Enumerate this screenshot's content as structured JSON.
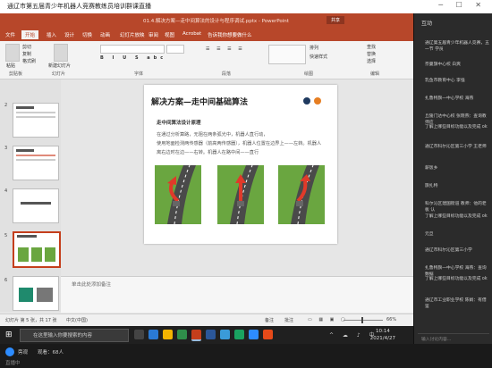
{
  "live_title": "通辽市第五届青少年机器人竞赛教练员培训群课直播",
  "ppt": {
    "window_title": "01.4.解决方案—走中间算法的设计与程序调试.pptx - PowerPoint",
    "user": "",
    "share_label": "共享",
    "tabs": [
      "文件",
      "开始",
      "插入",
      "设计",
      "切换",
      "动画",
      "幻灯片放映",
      "审阅",
      "视图",
      "Acrobat",
      "告诉我你想要做什么"
    ],
    "ribbon": {
      "paste": "粘贴",
      "cut": "剪切",
      "copy": "复制",
      "format_painter": "格式刷",
      "new_slide": "新建幻灯片",
      "groups": [
        "剪贴板",
        "幻灯片",
        "字体",
        "段落",
        "绘图",
        "编辑"
      ],
      "find": "查找",
      "replace": "替换",
      "select": "选择",
      "arrange": "排列",
      "quick_styles": "快速样式"
    },
    "thumb_numbers": [
      "2",
      "3",
      "4",
      "5",
      "6"
    ],
    "slide": {
      "title": "解决方案—走中间基础算法",
      "subtitle": "走中间算法设计原理",
      "lines": [
        "在通过分析算路，无阻在两条弧光中，机器人直行动，",
        "使用地面检测两传感器（前高两传感器），机器人位置在边界上——左转。机器人",
        "离右边时在边——右转。机器人在路中间——直行"
      ]
    },
    "notes_placeholder": "单击此处添加备注",
    "status": {
      "slide_info": "幻灯片 第 5 张，共 17 张",
      "language": "中文(中国)",
      "notes": "备注",
      "comments": "批注",
      "zoom": "66%"
    }
  },
  "taskbar": {
    "search_placeholder": "在这里输入你要搜索的内容",
    "time": "10:14",
    "date": "2021/4/27"
  },
  "sidebar": {
    "header": "互动",
    "messages": [
      "通辽第五届青少年机器人竞赛，五一节  学员",
      "奈曼旗中心校 白爽",
      "乳鱼市教育中心 李强",
      "扎鲁特旗一中心学校 海燕",
      "丘陵门达中心校 张晓燕：查询教师应",
      "了解上哪些目标功能以及完成 ok",
      "通辽市科尔沁区第三小学 王老师",
      "薪饭乡",
      "旗扎特",
      "科尔沁区建国街道 教师：他的老板 认",
      "了解上哪些目标功能以及完成 ok",
      "元旦",
      "通辽市科尔沁区第三小学",
      "扎鲁特旗一中心学校 海燕：查询数据",
      "了解上哪些目标功能以及完成 ok",
      "通辽市工业职业学校 陈娟：有借鉴"
    ],
    "chat_placeholder": "输入讨论内容..."
  },
  "bottom": {
    "left_label": "直播中",
    "viewer": "旁观",
    "people": "观看：68人"
  },
  "colors": {
    "accent": "#b7472a",
    "road": "#6aa640",
    "arrow": "#e03a2a"
  }
}
